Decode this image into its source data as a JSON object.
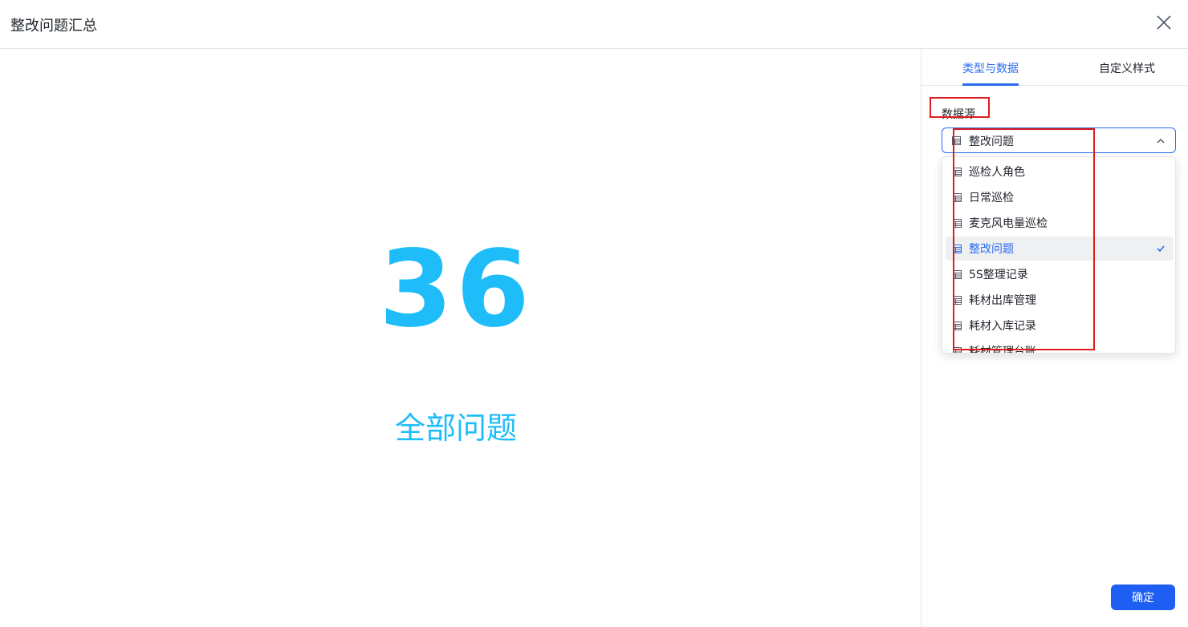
{
  "dialog": {
    "title": "整改问题汇总"
  },
  "preview": {
    "value": "36",
    "caption": "全部问题",
    "color": "#1ebdfa"
  },
  "tabs": [
    {
      "label": "类型与数据",
      "active": true
    },
    {
      "label": "自定义样式",
      "active": false
    }
  ],
  "datasource": {
    "label": "数据源",
    "selected": "整改问题",
    "options": [
      {
        "label": "巡检人角色",
        "selected": false
      },
      {
        "label": "日常巡检",
        "selected": false
      },
      {
        "label": "麦克风电量巡检",
        "selected": false
      },
      {
        "label": "整改问题",
        "selected": true
      },
      {
        "label": "5S整理记录",
        "selected": false
      },
      {
        "label": "耗材出库管理",
        "selected": false
      },
      {
        "label": "耗材入库记录",
        "selected": false
      },
      {
        "label": "耗材管理台账",
        "selected": false
      }
    ]
  },
  "footer": {
    "confirm_label": "确定"
  },
  "colors": {
    "accent": "#2a6bf2",
    "button": "#1e5ef2",
    "annotation": "#e01b1b"
  }
}
